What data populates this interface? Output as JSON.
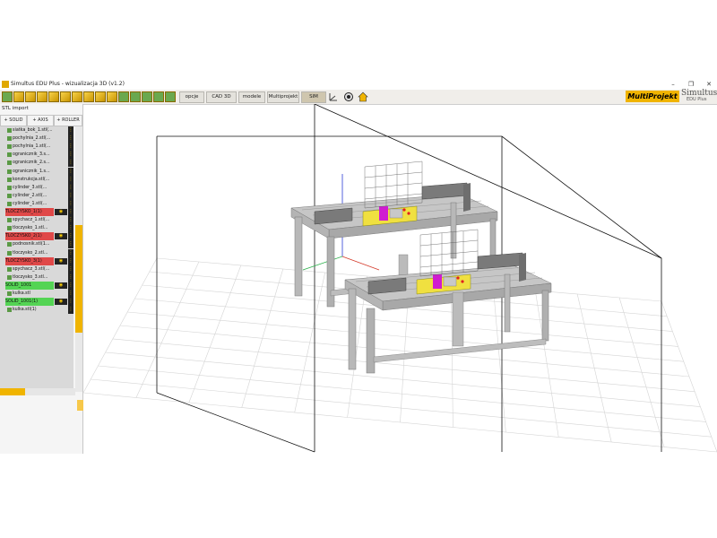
{
  "window": {
    "title": "Simultus EDU Plus - wizualizacja 3D (v1.2)",
    "controls": {
      "minimize": "–",
      "maximize": "❐",
      "close": "✕"
    }
  },
  "toolbar": {
    "tabs": [
      "opcje",
      "CAD 3D",
      "modele",
      "Multiprojekt",
      "SIM"
    ],
    "active_tab": "SIM",
    "icons": [
      "open-icon",
      "cube-icon",
      "cube-icon",
      "cube-icon",
      "cube-icon",
      "cube-icon",
      "cube-icon",
      "cube-icon",
      "cube-icon",
      "cube-icon",
      "save-icon",
      "copy-icon",
      "export-icon",
      "import-icon",
      "login-icon"
    ]
  },
  "brand": {
    "logo": "MultiProjekt",
    "product": "Simultus",
    "edition": "EDU Plus",
    "accent": "#f0b400"
  },
  "panel": {
    "title": "STL import",
    "buttons": [
      "+ SOLID",
      "+ AXIS",
      "+ ROLLER"
    ],
    "items": [
      {
        "label": "siatka_bok_1.stl(...",
        "type": "part"
      },
      {
        "label": "pochylnia_2.stl(...",
        "type": "part"
      },
      {
        "label": "pochylnia_1.stl(...",
        "type": "part"
      },
      {
        "label": "ogranicznik_3.s...",
        "type": "part"
      },
      {
        "label": "ogranicznik_2.s...",
        "type": "part"
      },
      {
        "label": "ogranicznik_1.s...",
        "type": "part"
      },
      {
        "label": "konstrukcja.stl(...",
        "type": "part"
      },
      {
        "label": "cylinder_3.stl(...",
        "type": "part"
      },
      {
        "label": "cylinder_2.stl(...",
        "type": "part"
      },
      {
        "label": "cylinder_1.stl(...",
        "type": "part"
      },
      {
        "label": "TLOCZYSKO_1(1)",
        "type": "axis"
      },
      {
        "label": "spychacz_1.stl(...",
        "type": "part"
      },
      {
        "label": "tloczysko_1.stl...",
        "type": "part"
      },
      {
        "label": "TLOCZYSKO_2(1)",
        "type": "axis"
      },
      {
        "label": "podnosnik.stl(1...",
        "type": "part"
      },
      {
        "label": "tloczysko_2.stl...",
        "type": "part"
      },
      {
        "label": "TLOCZYSKO_3(1)",
        "type": "axis"
      },
      {
        "label": "spychacz_3.stl(...",
        "type": "part"
      },
      {
        "label": "tloczysko_3.stl...",
        "type": "part"
      },
      {
        "label": "SOLID_1001",
        "type": "solid"
      },
      {
        "label": "kulka.stl",
        "type": "part"
      },
      {
        "label": "SOLID_1001(1)",
        "type": "solid"
      },
      {
        "label": "kulka.stl(1)",
        "type": "part"
      }
    ],
    "colors": {
      "axis": "#e04848",
      "solid": "#54d454",
      "part_icon": "#5a9a45"
    }
  }
}
